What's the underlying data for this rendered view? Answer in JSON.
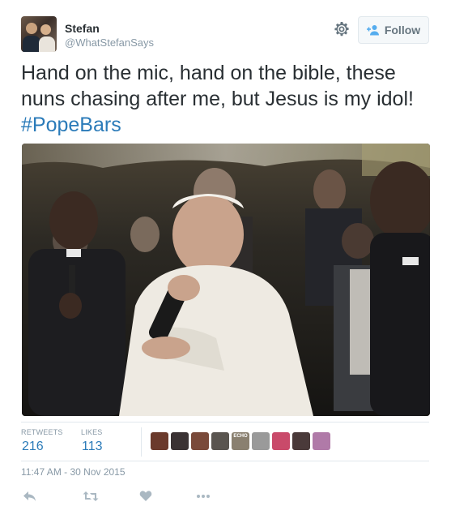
{
  "user": {
    "name": "Stefan",
    "handle": "@WhatStefanSays"
  },
  "follow_button": {
    "label": "Follow"
  },
  "tweet": {
    "text": "Hand on the mic, hand on the bible, these nuns chasing after me, but Jesus is my idol!",
    "hashtag": "#PopeBars"
  },
  "stats": {
    "retweets_label": "RETWEETS",
    "retweets_value": "216",
    "likes_label": "LIKES",
    "likes_value": "113"
  },
  "liker_avatars": [
    {
      "color": "#6b3a2c"
    },
    {
      "color": "#3a3233"
    },
    {
      "color": "#7a4a3a"
    },
    {
      "color": "#5a5550"
    },
    {
      "color": "#8a8070",
      "label": "ECHO"
    },
    {
      "color": "#9a9a9a"
    },
    {
      "color": "#c94a6a"
    },
    {
      "color": "#4a3a3a"
    },
    {
      "color": "#b07aa8"
    }
  ],
  "timestamp": "11:47 AM - 30 Nov 2015",
  "icons": {
    "settings": "gear-icon",
    "follow": "add-user-icon",
    "reply": "reply-icon",
    "retweet": "retweet-icon",
    "like": "heart-icon",
    "more": "more-icon"
  },
  "colors": {
    "link": "#2b7bb9",
    "muted": "#8899a6",
    "text": "#292f33"
  }
}
